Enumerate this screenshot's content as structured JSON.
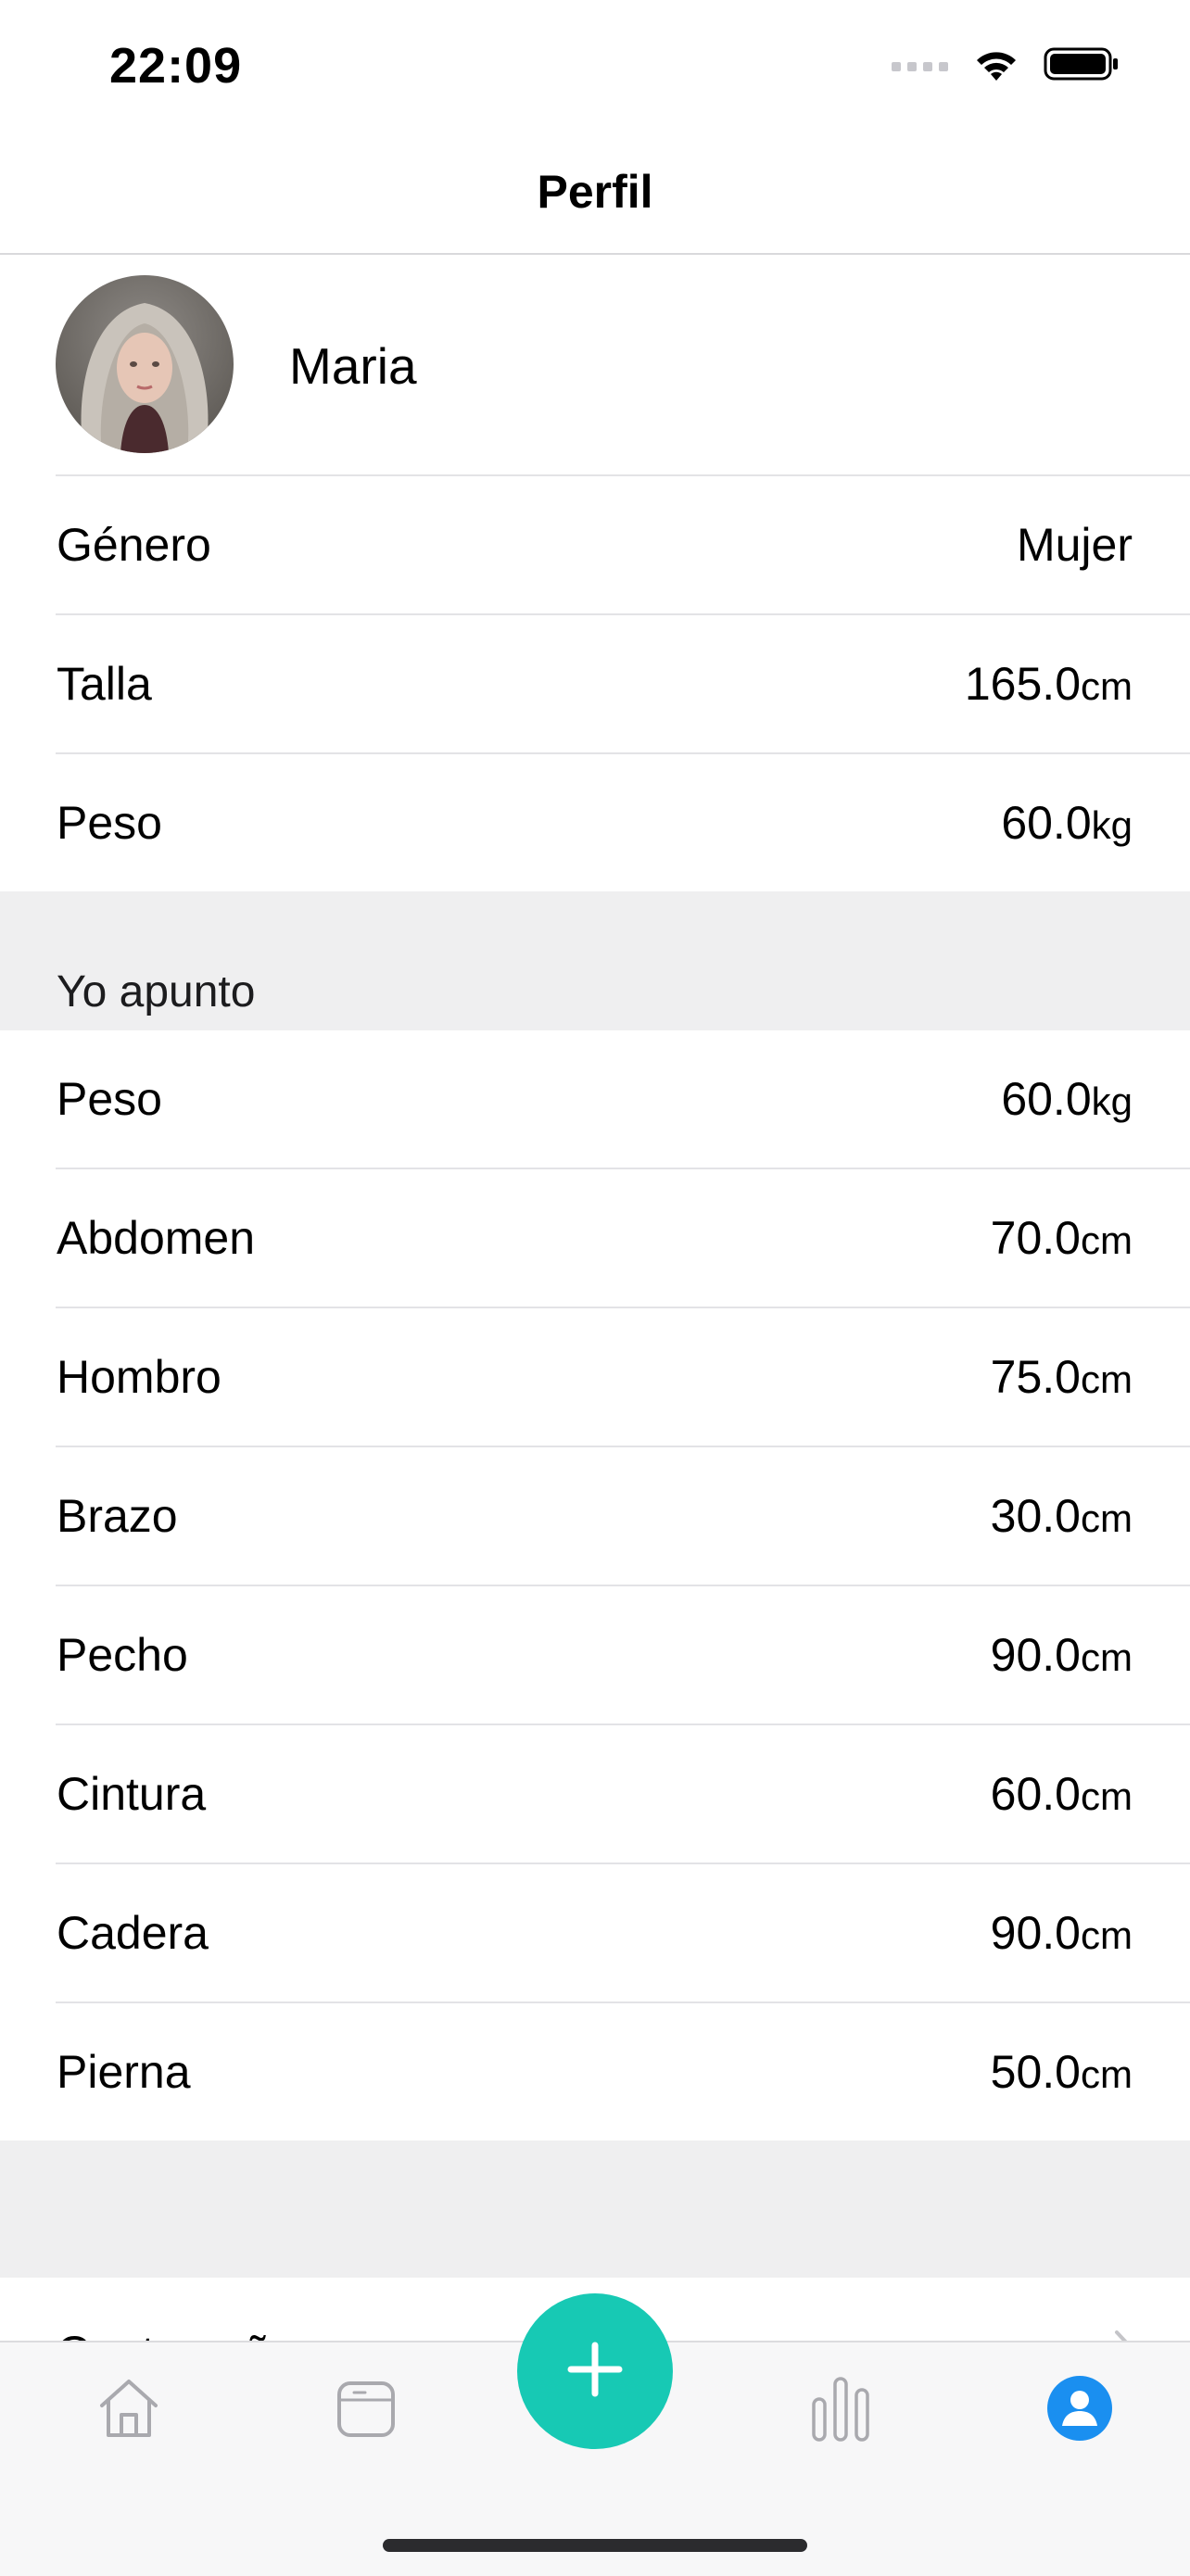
{
  "status_bar": {
    "time": "22:09",
    "icons": [
      "cellular-signal-icon",
      "wifi-icon",
      "battery-icon"
    ]
  },
  "nav": {
    "title": "Perfil"
  },
  "profile": {
    "name": "Maria",
    "rows": [
      {
        "label": "Género",
        "value": "Mujer",
        "unit": ""
      },
      {
        "label": "Talla",
        "value": "165.0",
        "unit": "cm"
      },
      {
        "label": "Peso",
        "value": "60.0",
        "unit": "kg"
      }
    ]
  },
  "measurements": {
    "header": "Yo apunto",
    "rows": [
      {
        "label": "Peso",
        "value": "60.0",
        "unit": "kg"
      },
      {
        "label": "Abdomen",
        "value": "70.0",
        "unit": "cm"
      },
      {
        "label": "Hombro",
        "value": "75.0",
        "unit": "cm"
      },
      {
        "label": "Brazo",
        "value": "30.0",
        "unit": "cm"
      },
      {
        "label": "Pecho",
        "value": "90.0",
        "unit": "cm"
      },
      {
        "label": "Cintura",
        "value": "60.0",
        "unit": "cm"
      },
      {
        "label": "Cadera",
        "value": "90.0",
        "unit": "cm"
      },
      {
        "label": "Pierna",
        "value": "50.0",
        "unit": "cm"
      }
    ]
  },
  "settings_partial": {
    "label": "Contraseña"
  },
  "tab_bar": {
    "tabs": [
      {
        "icon": "home-icon",
        "active": false
      },
      {
        "icon": "calendar-card-icon",
        "active": false
      },
      {
        "icon": "add-icon",
        "active": false
      },
      {
        "icon": "stats-bars-icon",
        "active": false
      },
      {
        "icon": "profile-icon",
        "active": true
      }
    ],
    "accent_color": "#17c9b4",
    "active_color": "#1a8ff0",
    "inactive_color": "#a9a9ae"
  }
}
